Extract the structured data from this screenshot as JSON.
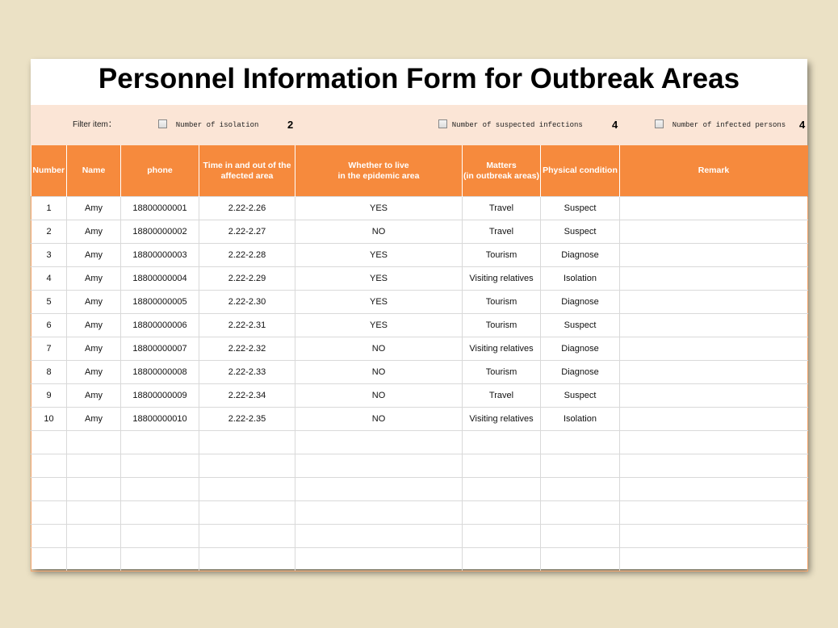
{
  "title": "Personnel Information Form for Outbreak Areas",
  "filter": {
    "label": "Filter item：",
    "items": [
      {
        "label": "Number of isolation",
        "count": "2"
      },
      {
        "label": "Number of suspected infections",
        "count": "4"
      },
      {
        "label": "Number of infected persons",
        "count": "4"
      }
    ]
  },
  "table": {
    "headers": [
      "Number",
      "Name",
      "phone",
      "Time in and out of the affected area",
      "Whether to live\nin the epidemic area",
      "Matters\n(in outbreak areas)",
      "Physical condition",
      "Remark"
    ],
    "rows": [
      [
        "1",
        "Amy",
        "18800000001",
        "2.22-2.26",
        "YES",
        "Travel",
        "Suspect",
        ""
      ],
      [
        "2",
        "Amy",
        "18800000002",
        "2.22-2.27",
        "NO",
        "Travel",
        "Suspect",
        ""
      ],
      [
        "3",
        "Amy",
        "18800000003",
        "2.22-2.28",
        "YES",
        "Tourism",
        "Diagnose",
        ""
      ],
      [
        "4",
        "Amy",
        "18800000004",
        "2.22-2.29",
        "YES",
        "Visiting relatives",
        "Isolation",
        ""
      ],
      [
        "5",
        "Amy",
        "18800000005",
        "2.22-2.30",
        "YES",
        "Tourism",
        "Diagnose",
        ""
      ],
      [
        "6",
        "Amy",
        "18800000006",
        "2.22-2.31",
        "YES",
        "Tourism",
        "Suspect",
        ""
      ],
      [
        "7",
        "Amy",
        "18800000007",
        "2.22-2.32",
        "NO",
        "Visiting relatives",
        "Diagnose",
        ""
      ],
      [
        "8",
        "Amy",
        "18800000008",
        "2.22-2.33",
        "NO",
        "Tourism",
        "Diagnose",
        ""
      ],
      [
        "9",
        "Amy",
        "18800000009",
        "2.22-2.34",
        "NO",
        "Travel",
        "Suspect",
        ""
      ],
      [
        "10",
        "Amy",
        "18800000010",
        "2.22-2.35",
        "NO",
        "Visiting relatives",
        "Isolation",
        ""
      ],
      [
        "",
        "",
        "",
        "",
        "",
        "",
        "",
        ""
      ],
      [
        "",
        "",
        "",
        "",
        "",
        "",
        "",
        ""
      ],
      [
        "",
        "",
        "",
        "",
        "",
        "",
        "",
        ""
      ],
      [
        "",
        "",
        "",
        "",
        "",
        "",
        "",
        ""
      ],
      [
        "",
        "",
        "",
        "",
        "",
        "",
        "",
        ""
      ],
      [
        "",
        "",
        "",
        "",
        "",
        "",
        "",
        ""
      ]
    ]
  },
  "colors": {
    "header_bg": "#f68a3d",
    "filter_bg": "#fbe5d6",
    "page_bg": "#ebe1c5"
  }
}
